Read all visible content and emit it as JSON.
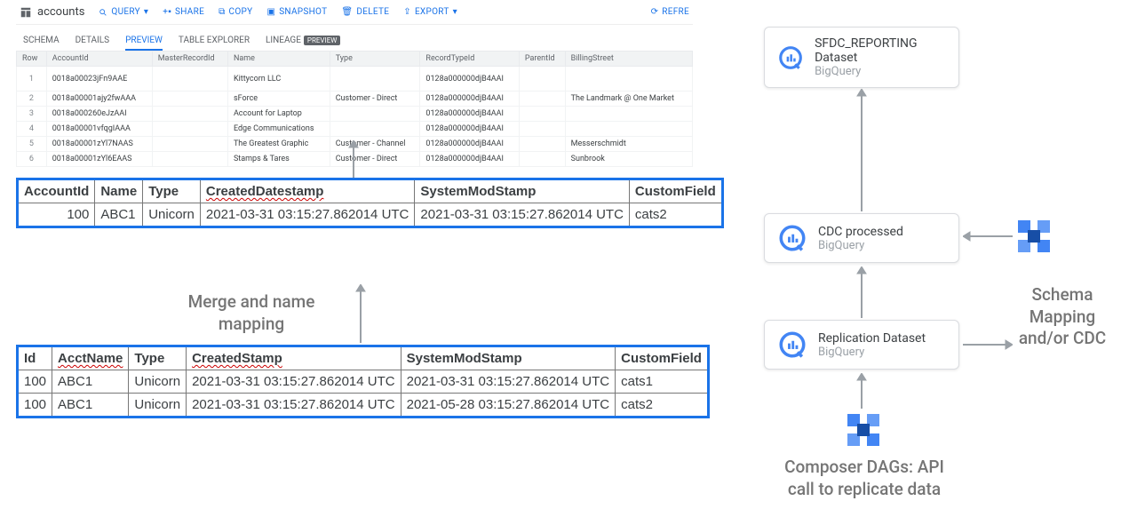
{
  "bq_header": {
    "title": "accounts",
    "query": "QUERY",
    "share": "SHARE",
    "copy": "COPY",
    "snapshot": "SNAPSHOT",
    "delete": "DELETE",
    "export": "EXPORT",
    "refresh": "REFRE"
  },
  "bq_tabs": {
    "schema": "SCHEMA",
    "details": "DETAILS",
    "preview": "PREVIEW",
    "explorer": "TABLE EXPLORER",
    "lineage": "LINEAGE",
    "badge": "PREVIEW"
  },
  "grid": {
    "cols": [
      "Row",
      "AccountId",
      "MasterRecordId",
      "Name",
      "Type",
      "RecordTypeId",
      "ParentId",
      "BillingStreet"
    ],
    "rows": [
      [
        "1",
        "0018a00023jFn9AAE",
        "",
        "Kittycorn LLC",
        "",
        "0128a000000djB4AAI",
        "",
        ""
      ],
      [
        "2",
        "0018a00001ajy2fwAAA",
        "",
        "sForce",
        "Customer - Direct",
        "0128a000000djB4AAI",
        "",
        "The Landmark @ One Market"
      ],
      [
        "3",
        "0018a000260eJzAAI",
        "",
        "Account for Laptop",
        "",
        "0128a000000djB4AAI",
        "",
        ""
      ],
      [
        "4",
        "0018a00001vfqgIAAA",
        "",
        "Edge Communications",
        "",
        "0128a000000djB4AAI",
        "",
        ""
      ],
      [
        "5",
        "0018a00001zYl7NAAS",
        "",
        "The Greatest Graphic",
        "Customer - Channel",
        "0128a000000djB4AAI",
        "",
        "Messerschmidt"
      ],
      [
        "6",
        "0018a00001zYl6EAAS",
        "",
        "Stamps & Tares",
        "Customer - Direct",
        "0128a000000djB4AAI",
        "",
        "Sunbrook"
      ]
    ]
  },
  "mapped": {
    "cols": [
      "AccountId",
      "Name",
      "Type",
      "CreatedDatestamp",
      "SystemModStamp",
      "CustomField"
    ],
    "row": [
      "100",
      "ABC1",
      "Unicorn",
      "2021-03-31 03:15:27.862014 UTC",
      "2021-03-31 03:15:27.862014 UTC",
      "cats2"
    ]
  },
  "source": {
    "cols": [
      "Id",
      "AcctName",
      "Type",
      "CreatedStamp",
      "SystemModStamp",
      "CustomField"
    ],
    "rows": [
      [
        "100",
        "ABC1",
        "Unicorn",
        "2021-03-31 03:15:27.862014 UTC",
        "2021-03-31 03:15:27.862014 UTC",
        "cats1"
      ],
      [
        "100",
        "ABC1",
        "Unicorn",
        "2021-03-31 03:15:27.862014 UTC",
        "2021-05-28 03:15:27.862014 UTC",
        "cats2"
      ]
    ]
  },
  "labels": {
    "merge": "Merge and name mapping",
    "schema": "Schema Mapping and/or CDC",
    "composer": "Composer DAGs: API call to replicate data"
  },
  "nodes": {
    "top": {
      "title": "SFDC_REPORTING Dataset",
      "sub": "BigQuery"
    },
    "mid": {
      "title": "CDC processed",
      "sub": "BigQuery"
    },
    "bot": {
      "title": "Replication Dataset",
      "sub": "BigQuery"
    }
  }
}
